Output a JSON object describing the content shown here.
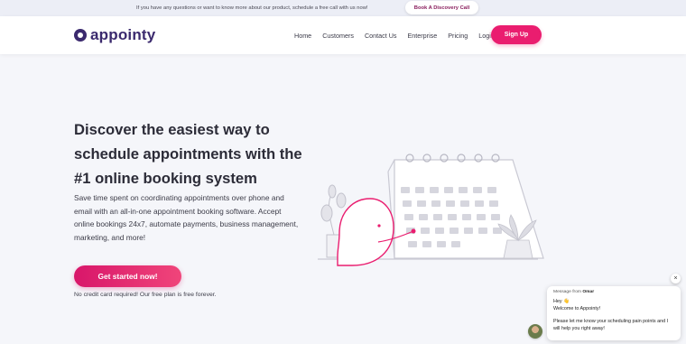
{
  "announcement": {
    "text": "If you have any questions or want to know more about our product, schedule a free call with us now!",
    "button_label": "Book A Discovery Call"
  },
  "header": {
    "logo_text": "appointy",
    "nav": [
      "Home",
      "Customers",
      "Contact Us",
      "Enterprise",
      "Pricing",
      "Login"
    ],
    "signup_label": "Sign Up"
  },
  "hero": {
    "headline": "Discover the easiest way to schedule appointments with the #1 online booking system",
    "subtext": "Save time spent on coordinating appointments over phone and email with an all-in-one appointment booking software. Accept online bookings 24x7, automate payments, business management, marketing, and more!",
    "cta_label": "Get started now!",
    "note": "No credit card required! Our free plan is free forever."
  },
  "chat": {
    "from_prefix": "Message from",
    "from_name": "Omar",
    "greeting": "Hey 👋",
    "welcome": "Welcome to Appointy!",
    "message": "Please let me know your scheduling pain points and I will help you right away!",
    "close_label": "×"
  },
  "colors": {
    "brand": "#3b2a6e",
    "accent": "#ea1d6f",
    "background": "#f5f6fa"
  }
}
